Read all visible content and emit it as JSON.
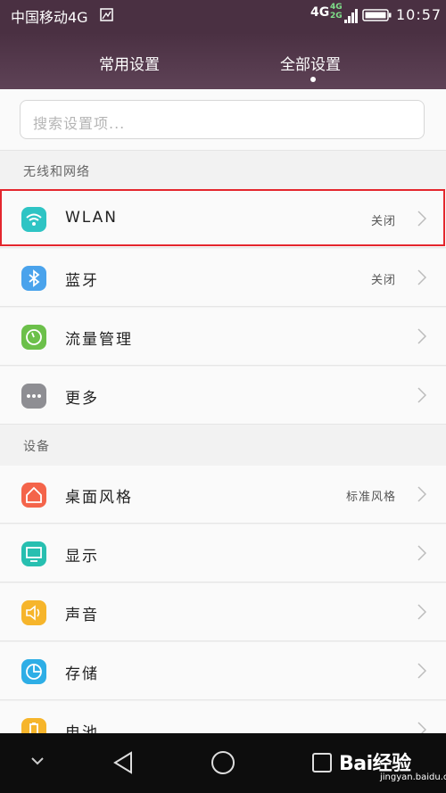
{
  "status_bar": {
    "carrier": "中国移动4G",
    "network_main": "4G",
    "network_stack_top": "4G",
    "network_stack_bottom": "2G",
    "time": "10:57",
    "icons": [
      "sim-card-icon",
      "signal-icon",
      "battery-icon"
    ]
  },
  "tabs": [
    {
      "label": "常用设置",
      "active": false
    },
    {
      "label": "全部设置",
      "active": true
    }
  ],
  "search": {
    "placeholder": "搜索设置项..."
  },
  "sections": [
    {
      "title": "无线和网络",
      "items": [
        {
          "label": "WLAN",
          "value": "关闭",
          "icon": "wifi-icon",
          "icon_color": "#2ec4c4"
        },
        {
          "label": "蓝牙",
          "value": "关闭",
          "icon": "bluetooth-icon",
          "icon_color": "#4aa3ec"
        },
        {
          "label": "流量管理",
          "value": "",
          "icon": "data-usage-icon",
          "icon_color": "#6cc04a"
        },
        {
          "label": "更多",
          "value": "",
          "icon": "more-icon",
          "icon_color": "#8e8e93"
        }
      ]
    },
    {
      "title": "设备",
      "items": [
        {
          "label": "桌面风格",
          "value": "标准风格",
          "icon": "home-icon",
          "icon_color": "#f4644a"
        },
        {
          "label": "显示",
          "value": "",
          "icon": "display-icon",
          "icon_color": "#27bfb0"
        },
        {
          "label": "声音",
          "value": "",
          "icon": "sound-icon",
          "icon_color": "#f6b52b"
        },
        {
          "label": "存储",
          "value": "",
          "icon": "storage-icon",
          "icon_color": "#2eaee6"
        },
        {
          "label": "电池",
          "value": "",
          "icon": "battery-setting-icon",
          "icon_color": "#f6b52b"
        }
      ]
    }
  ],
  "highlight_color": "#e4262d",
  "nav_bar": {
    "icons": [
      "chevron-down-icon",
      "back-icon",
      "home-circle-icon",
      "recent-apps-icon"
    ]
  },
  "watermark": {
    "text": "Bai经验",
    "sub": "jingyan.baidu.com"
  }
}
